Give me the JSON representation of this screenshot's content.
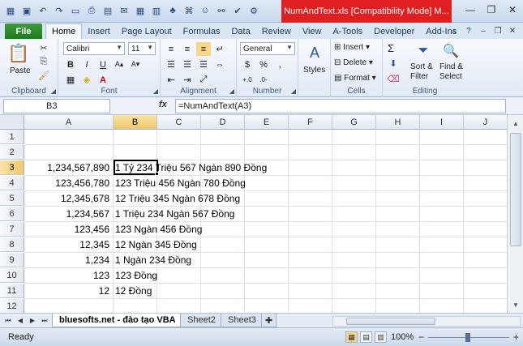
{
  "window": {
    "title": "NumAndText.xls  [Compatibility Mode]  M..."
  },
  "tabs": {
    "file": "File",
    "items": [
      "Home",
      "Insert",
      "Page Layout",
      "Formulas",
      "Data",
      "Review",
      "View",
      "A-Tools",
      "Developer",
      "Add-Ins"
    ]
  },
  "ribbon": {
    "clipboard": {
      "paste": "Paste",
      "label": "Clipboard"
    },
    "font": {
      "name": "Calibri",
      "size": "11",
      "label": "Font"
    },
    "alignment": {
      "label": "Alignment"
    },
    "number": {
      "format": "General",
      "dollar": "$",
      "percent": "%",
      "comma": ",",
      "label": "Number"
    },
    "styles": {
      "styles": "Styles"
    },
    "cells": {
      "insert": "Insert",
      "delete": "Delete",
      "format": "Format",
      "label": "Cells"
    },
    "editing": {
      "sum": "Σ",
      "sort": "Sort &",
      "filter": "Filter",
      "find": "Find &",
      "select": "Select",
      "label": "Editing"
    }
  },
  "formula_bar": {
    "name_box": "B3",
    "fx": "fx",
    "formula": "=NumAndText(A3)"
  },
  "grid": {
    "columns": [
      "A",
      "B",
      "C",
      "D",
      "E",
      "F",
      "G",
      "H",
      "I",
      "J"
    ],
    "rows": [
      "1",
      "2",
      "3",
      "4",
      "5",
      "6",
      "7",
      "8",
      "9",
      "10",
      "11",
      "12"
    ],
    "selected_column": "B",
    "selected_row": "3",
    "data": [
      {
        "a": "1,234,567,890",
        "b": "1 Tỷ 234 Triệu 567 Ngàn 890 Đồng"
      },
      {
        "a": "123,456,780",
        "b": "123 Triệu 456 Ngàn 780 Đồng"
      },
      {
        "a": "12,345,678",
        "b": "12 Triệu 345 Ngàn 678 Đồng"
      },
      {
        "a": "1,234,567",
        "b": "1 Triệu 234 Ngàn 567 Đồng"
      },
      {
        "a": "123,456",
        "b": "123 Ngàn 456 Đồng"
      },
      {
        "a": "12,345",
        "b": "12 Ngàn 345 Đồng"
      },
      {
        "a": "1,234",
        "b": "1 Ngàn 234 Đồng"
      },
      {
        "a": "123",
        "b": "123 Đồng"
      },
      {
        "a": "12",
        "b": "12 Đồng"
      }
    ]
  },
  "sheets": {
    "active": "bluesofts.net - đào tạo VBA",
    "others": [
      "Sheet2",
      "Sheet3"
    ]
  },
  "status": {
    "ready": "Ready",
    "zoom": "100%"
  },
  "colors": {
    "title_red": "#e02020",
    "file_green": "#1f7a1f",
    "selection_header": "#f2c86a"
  }
}
